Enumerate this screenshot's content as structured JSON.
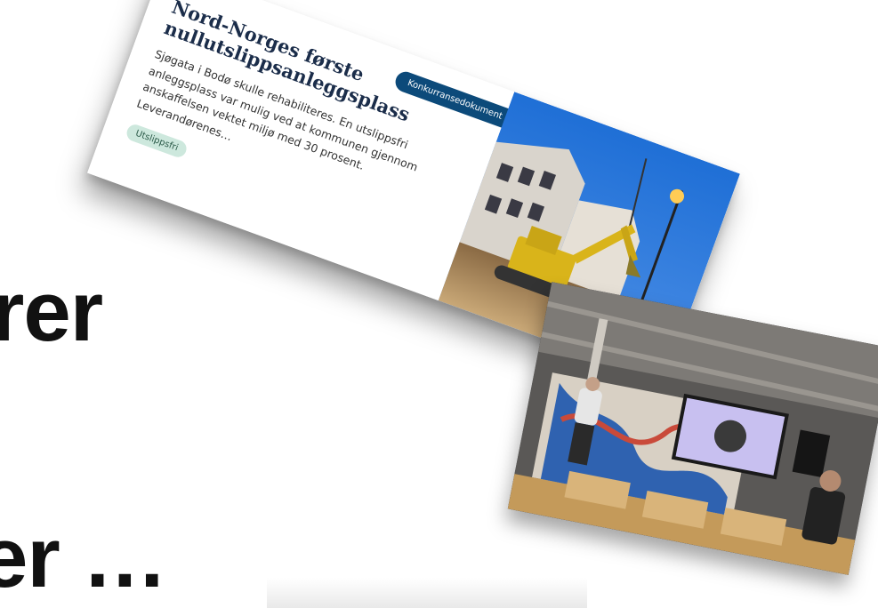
{
  "slide": {
    "line1": "rer",
    "line2": "er …"
  },
  "article_card": {
    "title": "Nord-Norges første nullutslippsanleggsplass",
    "button_label": "Konkurransedokument",
    "description": "Sjøgata i Bodø skulle rehabiliteres. En utslippsfri anleggsplass var mulig ved at kommunen gjennom anskaffelsen vektet miljø med 30 prosent. Leverandørenes…",
    "tag": "Utslippsfri",
    "colors": {
      "button": "#0c4a7a",
      "tag_bg": "#cde8dd",
      "title": "#1b2d4a"
    },
    "image": "excavator-at-night-construction-site"
  },
  "event_photo": {
    "image": "speaker-presenting-at-screen-in-meeting-room"
  }
}
